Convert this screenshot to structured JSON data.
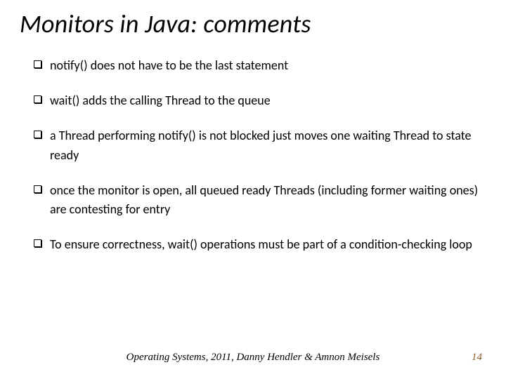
{
  "title": "Monitors  in Java: comments",
  "bullets": [
    "notify()  does not have to be the last statement",
    "wait()  adds the calling Thread to the queue",
    "a Thread performing notify() is not blocked just moves one waiting Thread to state ready",
    "once the monitor is open, all queued ready Threads (including former waiting ones) are contesting for entry",
    "To ensure correctness, wait() operations must be part of a condition-checking loop"
  ],
  "footer": "Operating Systems, 2011, Danny Hendler & Amnon Meisels",
  "page_number": "14"
}
